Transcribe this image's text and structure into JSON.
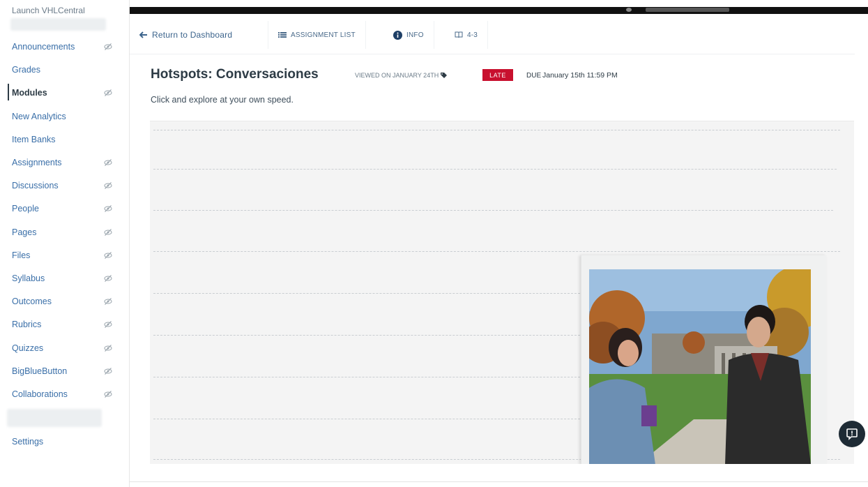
{
  "sidebar": {
    "launch_label": "Launch VHLCentral",
    "items": [
      {
        "label": "Announcements",
        "eye": true
      },
      {
        "label": "Grades",
        "eye": false
      },
      {
        "label": "Modules",
        "eye": true,
        "active": true
      },
      {
        "label": "New Analytics",
        "eye": false
      },
      {
        "label": "Item Banks",
        "eye": false
      },
      {
        "label": "Assignments",
        "eye": true
      },
      {
        "label": "Discussions",
        "eye": true
      },
      {
        "label": "People",
        "eye": true
      },
      {
        "label": "Pages",
        "eye": true
      },
      {
        "label": "Files",
        "eye": true
      },
      {
        "label": "Syllabus",
        "eye": true
      },
      {
        "label": "Outcomes",
        "eye": true
      },
      {
        "label": "Rubrics",
        "eye": true
      },
      {
        "label": "Quizzes",
        "eye": true
      },
      {
        "label": "BigBlueButton",
        "eye": true
      },
      {
        "label": "Collaborations",
        "eye": true
      }
    ],
    "settings_label": "Settings"
  },
  "nav": {
    "return_label": "Return to Dashboard",
    "assignment_list_label": "ASSIGNMENT LIST",
    "info_label": "INFO",
    "page_label": "4-3"
  },
  "assignment": {
    "title": "Hotspots: Conversaciones",
    "viewed": "VIEWED ON JANUARY 24TH",
    "status_badge": "LATE",
    "due_key": "DUE",
    "due_value": "January 15th 11:59 PM",
    "instructions": "Click and explore at your own speed."
  },
  "colors": {
    "late_badge": "#c8102e",
    "link": "#3a6fa8",
    "chat_bubble": "#1e2b35"
  }
}
